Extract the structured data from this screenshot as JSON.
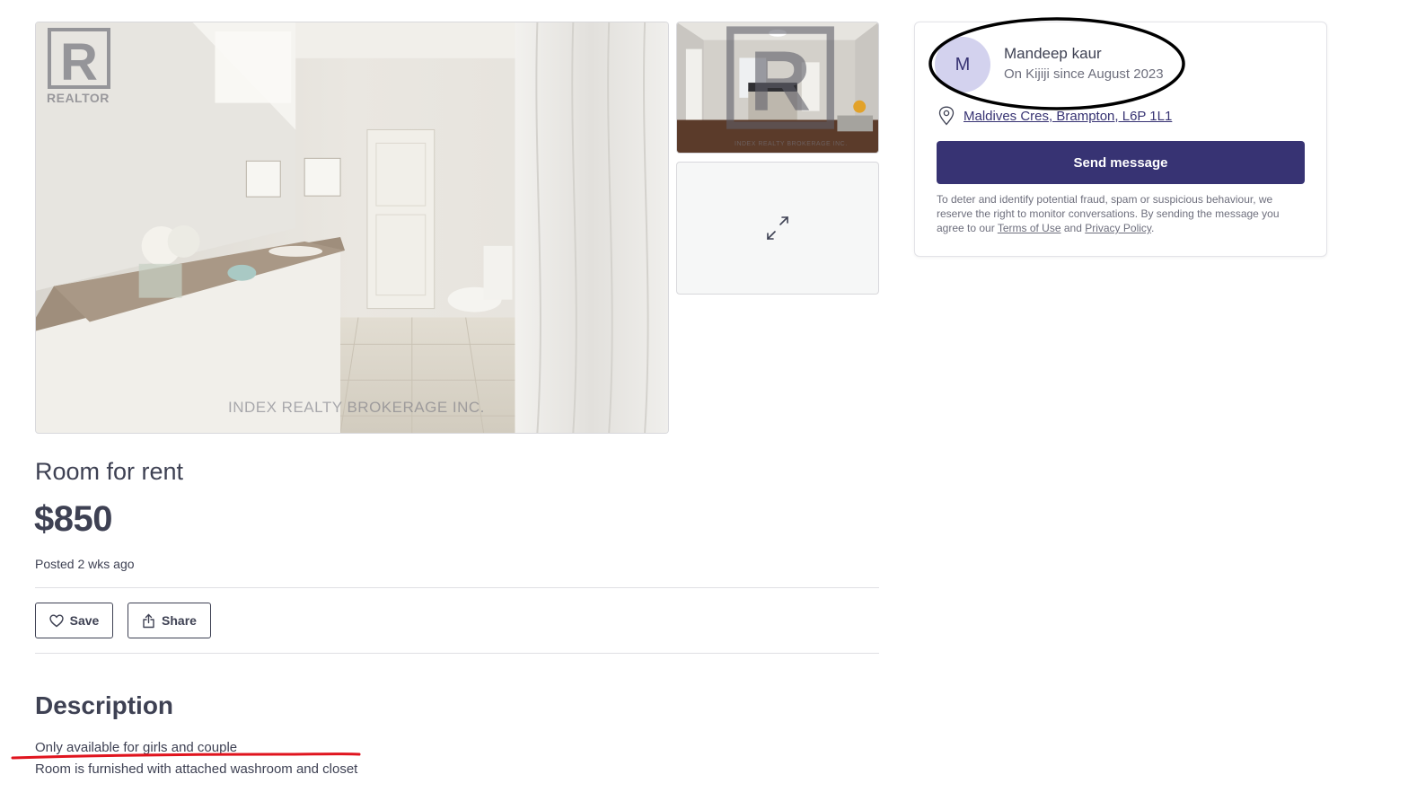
{
  "gallery": {
    "main_watermark_logo": "REALTOR",
    "main_watermark_text": "INDEX REALTY BROKERAGE INC.",
    "thumb_watermark_text": "INDEX REALTY BROKERAGE INC."
  },
  "listing": {
    "title": "Room for rent",
    "price": "$850",
    "posted": "Posted 2 wks ago"
  },
  "actions": {
    "save_label": "Save",
    "share_label": "Share"
  },
  "description": {
    "heading": "Description",
    "lines": [
      "Only available for girls and couple",
      "Room is furnished with attached washroom and closet"
    ]
  },
  "seller": {
    "avatar_initial": "M",
    "name": "Mandeep kaur",
    "since": "On Kijiji since August 2023",
    "location": "Maldives Cres, Brampton, L6P 1L1"
  },
  "contact": {
    "send_label": "Send message",
    "disclaimer_pre": "To deter and identify potential fraud, spam or suspicious behaviour, we reserve the right to monitor conversations. By sending the message you agree to our ",
    "terms_label": "Terms of Use",
    "disclaimer_and": " and ",
    "privacy_label": "Privacy Policy",
    "disclaimer_end": "."
  },
  "colors": {
    "primary": "#373373",
    "text": "#3e4153",
    "avatar_bg": "#d3d2ee",
    "annotation_red": "#e0141e"
  }
}
